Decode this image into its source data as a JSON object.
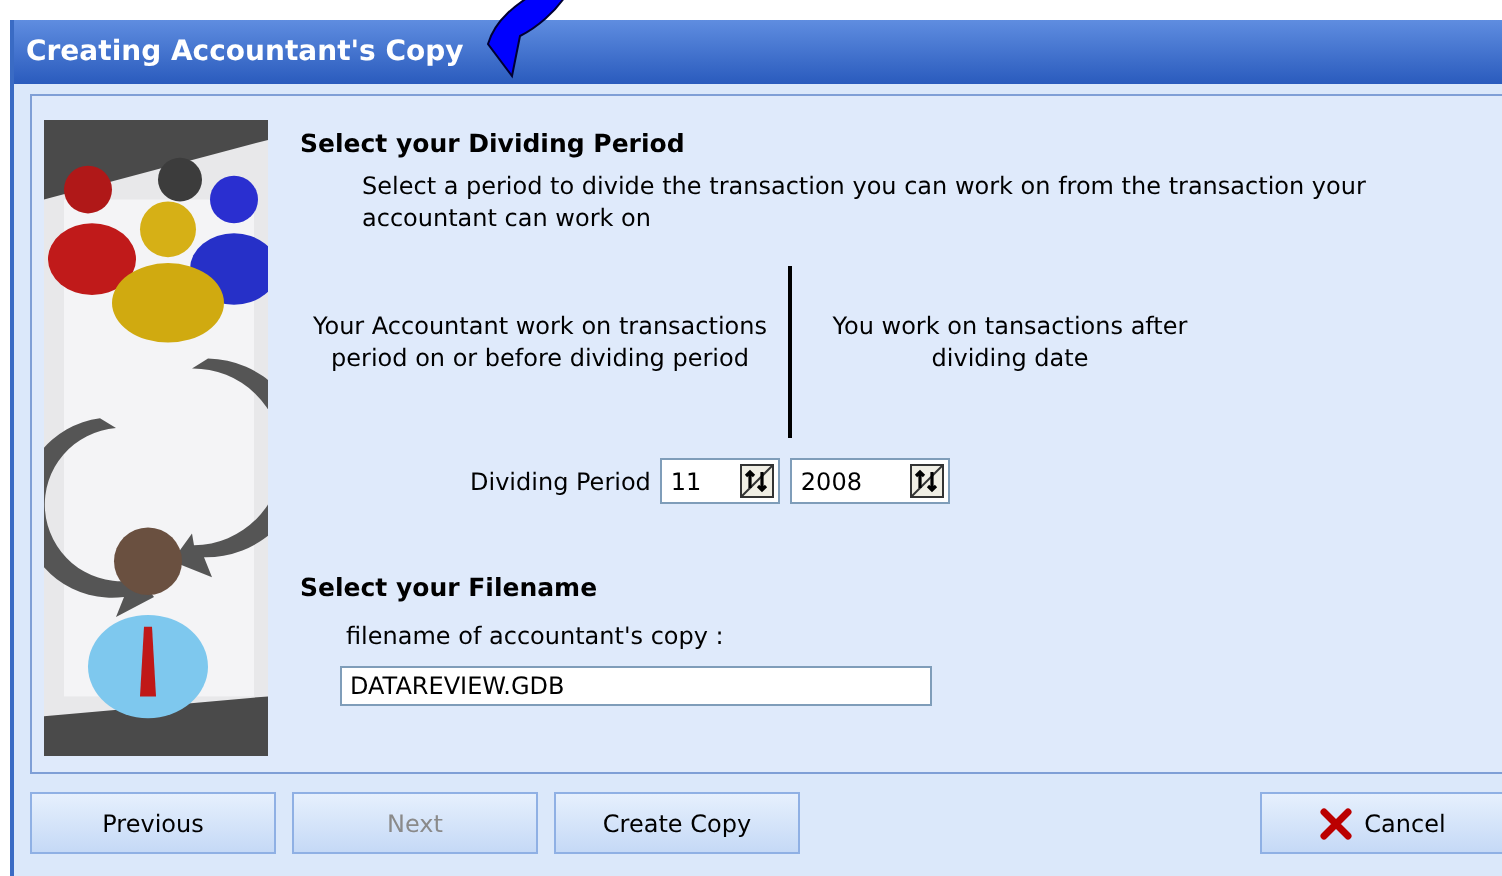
{
  "window": {
    "title": "Creating Accountant's Copy"
  },
  "period_section": {
    "heading": "Select your Dividing Period",
    "description": "Select a period to divide the transaction you can work on from the transaction your accountant can work on",
    "left_note": "Your Accountant work  on transactions period on or before dividing period",
    "right_note": "You work on tansactions after dividing date",
    "label": "Dividing Period",
    "month": "11",
    "year": "2008"
  },
  "file_section": {
    "heading": "Select your Filename",
    "label": "filename of accountant's copy :",
    "value": "DATAREVIEW.GDB"
  },
  "buttons": [
    {
      "label": "Previous",
      "disabled": false,
      "kind": "plain"
    },
    {
      "label": "Next",
      "disabled": true,
      "kind": "plain"
    },
    {
      "label": "Create Copy",
      "disabled": false,
      "kind": "plain"
    },
    {
      "label": "Cancel",
      "disabled": false,
      "kind": "cancel"
    }
  ]
}
